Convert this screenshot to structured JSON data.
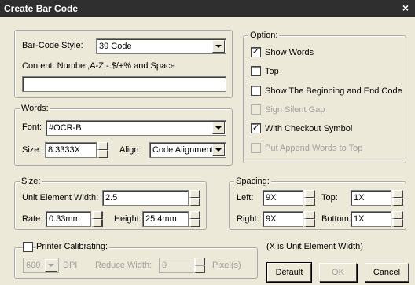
{
  "window": {
    "title": "Create Bar Code",
    "close_glyph": "×"
  },
  "barcode": {
    "style_label": "Bar-Code Style:",
    "style_value": "39 Code",
    "content_label": "Content: Number,A-Z,-.$/+% and Space",
    "content_value": ""
  },
  "words": {
    "legend": "Words:",
    "font_label": "Font:",
    "font_value": "#OCR-B",
    "size_label": "Size:",
    "size_value": "8.3333X",
    "align_label": "Align:",
    "align_value": "Code Alignment"
  },
  "option": {
    "legend": "Option:",
    "items": [
      {
        "label": "Show Words",
        "checked": true,
        "enabled": true
      },
      {
        "label": "Top",
        "checked": false,
        "enabled": true
      },
      {
        "label": "Show The Beginning and End Code",
        "checked": false,
        "enabled": true
      },
      {
        "label": "Sign Silent Gap",
        "checked": false,
        "enabled": false
      },
      {
        "label": "With Checkout Symbol",
        "checked": true,
        "enabled": true
      },
      {
        "label": "Put Append Words to Top",
        "checked": false,
        "enabled": false
      }
    ]
  },
  "size": {
    "legend": "Size:",
    "unit_label": "Unit Element Width:",
    "unit_value": "2.5",
    "rate_label": "Rate:",
    "rate_value": "0.33mm",
    "height_label": "Height:",
    "height_value": "25.4mm"
  },
  "spacing": {
    "legend": "Spacing:",
    "left_label": "Left:",
    "left_value": "9X",
    "top_label": "Top:",
    "top_value": "1X",
    "right_label": "Right:",
    "right_value": "9X",
    "bottom_label": "Bottom:",
    "bottom_value": "1X"
  },
  "printer": {
    "label": "Printer Calibrating:",
    "dpi_value": "600",
    "dpi_label": "DPI",
    "reduce_label": "Reduce Width:",
    "reduce_value": "0",
    "pixels_label": "Pixel(s)"
  },
  "footer": {
    "note": "(X is Unit Element Width)",
    "default_label": "Default",
    "ok_label": "OK",
    "cancel_label": "Cancel"
  },
  "check_glyph": "✓"
}
